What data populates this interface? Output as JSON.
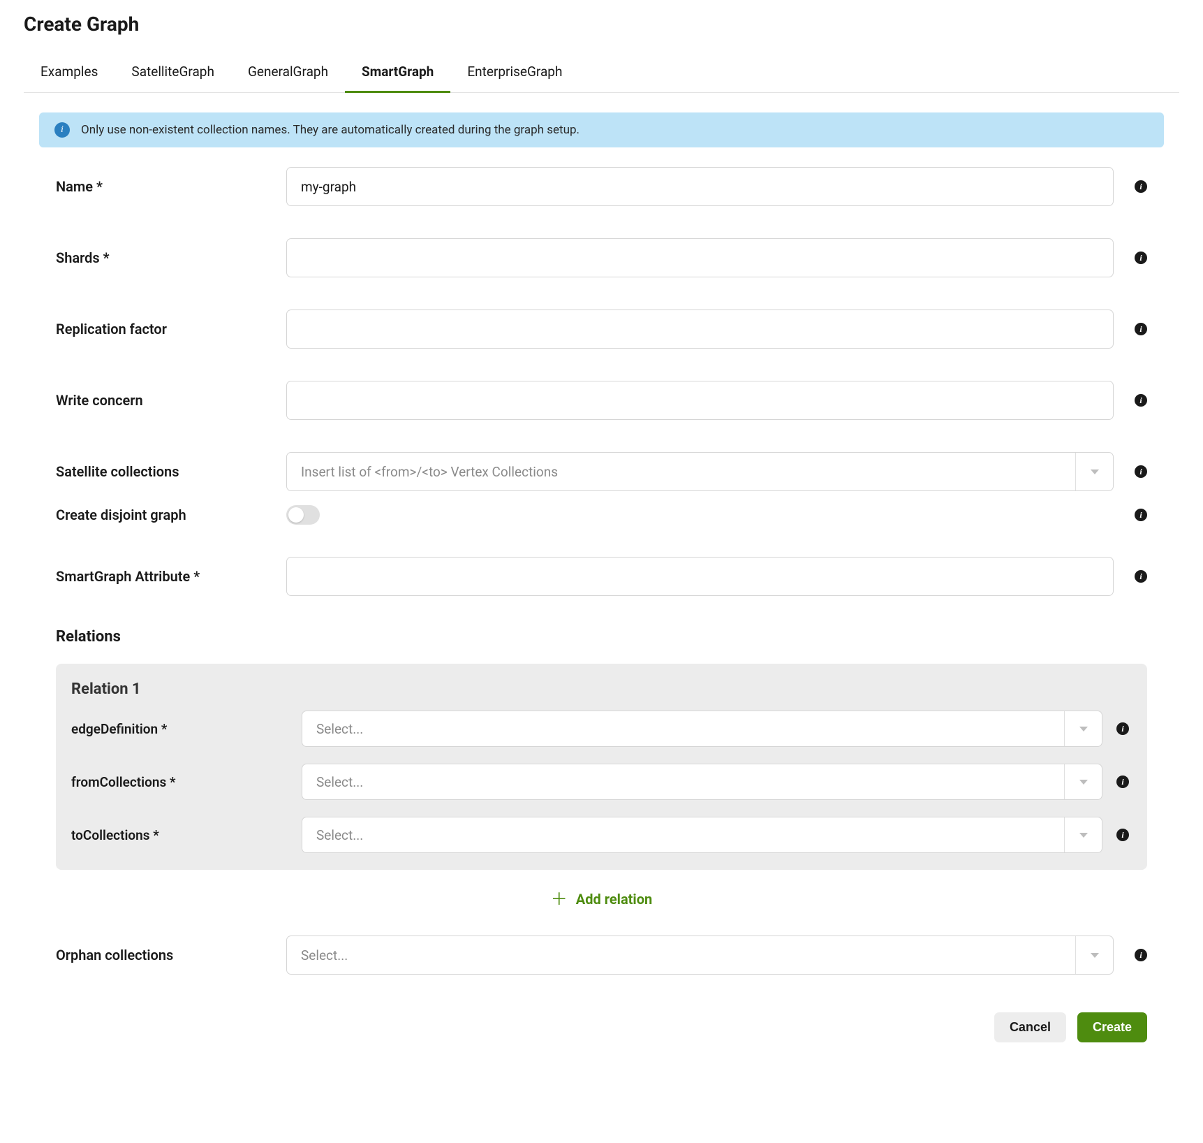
{
  "title": "Create Graph",
  "tabs": [
    {
      "label": "Examples",
      "active": false
    },
    {
      "label": "SatelliteGraph",
      "active": false
    },
    {
      "label": "GeneralGraph",
      "active": false
    },
    {
      "label": "SmartGraph",
      "active": true
    },
    {
      "label": "EnterpriseGraph",
      "active": false
    }
  ],
  "banner": {
    "text": "Only use non-existent collection names. They are automatically created during the graph setup."
  },
  "fields": {
    "name": {
      "label": "Name *",
      "value": "my-graph"
    },
    "shards": {
      "label": "Shards *",
      "value": ""
    },
    "replication": {
      "label": "Replication factor",
      "value": ""
    },
    "writeConcern": {
      "label": "Write concern",
      "value": ""
    },
    "satelliteCollections": {
      "label": "Satellite collections",
      "placeholder": "Insert list of <from>/<to> Vertex Collections"
    },
    "disjoint": {
      "label": "Create disjoint graph",
      "value": false
    },
    "smartAttr": {
      "label": "SmartGraph Attribute *",
      "value": ""
    },
    "orphan": {
      "label": "Orphan collections",
      "placeholder": "Select..."
    }
  },
  "relationsHeading": "Relations",
  "relations": [
    {
      "title": "Relation 1",
      "edgeDefinition": {
        "label": "edgeDefinition *",
        "placeholder": "Select..."
      },
      "fromCollections": {
        "label": "fromCollections *",
        "placeholder": "Select..."
      },
      "toCollections": {
        "label": "toCollections *",
        "placeholder": "Select..."
      }
    }
  ],
  "addRelationLabel": "Add relation",
  "buttons": {
    "cancel": "Cancel",
    "create": "Create"
  },
  "icons": {
    "info": "i",
    "help": "i"
  }
}
